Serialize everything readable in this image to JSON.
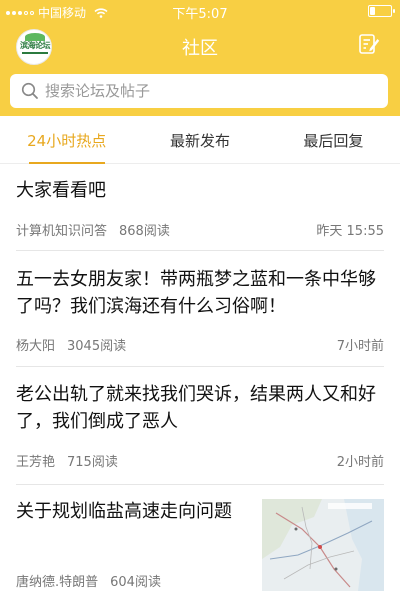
{
  "status_bar": {
    "carrier": "中国移动",
    "time": "下午5:07"
  },
  "header": {
    "title": "社区",
    "logo_text": "滨海论坛"
  },
  "search": {
    "placeholder": "搜索论坛及帖子"
  },
  "tabs": [
    {
      "label": "24小时热点",
      "active": true
    },
    {
      "label": "最新发布",
      "active": false
    },
    {
      "label": "最后回复",
      "active": false
    }
  ],
  "posts": [
    {
      "title": "大家看看吧",
      "author": "计算机知识问答",
      "reads": "868阅读",
      "time": "昨天 15:55"
    },
    {
      "title": "五一去女朋友家！带两瓶梦之蓝和一条中华够了吗？我们滨海还有什么习俗啊！",
      "author": "杨大阳",
      "reads": "3045阅读",
      "time": "7小时前"
    },
    {
      "title": "老公出轨了就来找我们哭诉，结果两人又和好了，我们倒成了恶人",
      "author": "王芳艳",
      "reads": "715阅读",
      "time": "2小时前"
    },
    {
      "title": "关于规划临盐高速走向问题",
      "author": "唐纳德.特朗普",
      "reads": "604阅读",
      "time": ""
    }
  ],
  "colors": {
    "brand": "#f8cf43",
    "tab_active": "#e8a81f"
  }
}
